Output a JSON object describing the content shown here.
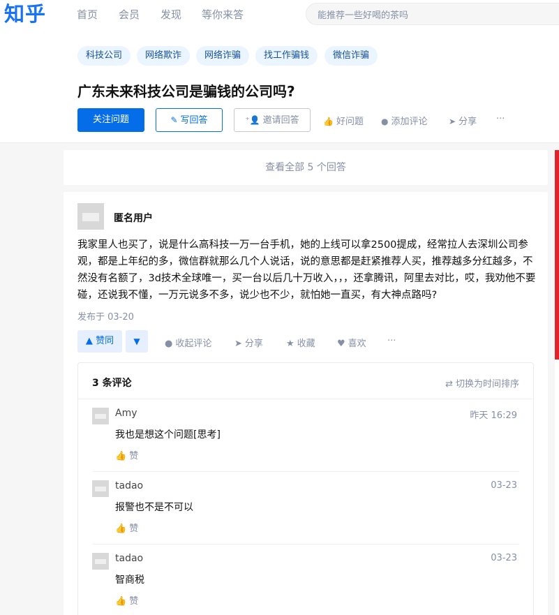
{
  "nav": {
    "logo": "知乎",
    "links": [
      "首页",
      "会员",
      "发现",
      "等你来答"
    ],
    "search_placeholder": "能推荐一些好喝的茶吗"
  },
  "question": {
    "topics": [
      "科技公司",
      "网络欺诈",
      "网络诈骗",
      "找工作骗钱",
      "微信诈骗"
    ],
    "title": "广东未来科技公司是骗钱的公司吗?",
    "follow_label": "关注问题",
    "write_label": "写回答",
    "invite_label": "邀请回答",
    "good_label": "好问题",
    "comment_label": "添加评论",
    "share_label": "分享",
    "more_label": "···"
  },
  "view_all": "查看全部 5 个回答",
  "answer": {
    "author": "匿名用户",
    "content": "我家里人也买了，说是什么高科技一万一台手机，她的上线可以拿2500提成，经常拉人去深圳公司参观，都是上年纪的多，微信群就那么几个人说话，说的意思都是赶紧推荐人买，推荐越多分红越多，不然没有名额了，3d技术全球唯一，买一台以后几十万收入，，，还拿腾讯，阿里去对比，哎，我劝他不要碰，还说我不懂，一万元说多不多，说少也不少，就怕她一直买，有大神点路吗?",
    "published": "发布于 03-20",
    "vote_label": "赞同",
    "collapse_label": "收起评论",
    "share_label": "分享",
    "collect_label": "收藏",
    "like_label": "喜欢",
    "more_label": "···"
  },
  "comments": {
    "count_label": "3 条评论",
    "sort_label": "切换为时间排序",
    "like_label": "赞",
    "items": [
      {
        "name": "Amy",
        "time": "昨天 16:29",
        "text": "我也是想这个问题[思考]"
      },
      {
        "name": "tadao",
        "time": "03-23",
        "text": "报警也不是不可以"
      },
      {
        "name": "tadao",
        "time": "03-23",
        "text": "智商税"
      }
    ]
  }
}
